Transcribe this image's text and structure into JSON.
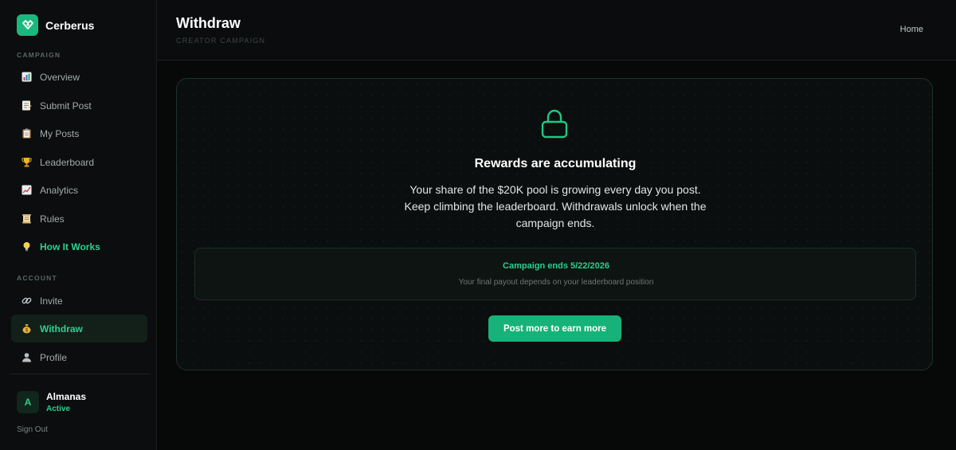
{
  "brand": {
    "name": "Cerberus",
    "logo_icon": "shield-heart-icon",
    "accent": "#19b97e"
  },
  "sidebar": {
    "campaign_label": "CAMPAIGN",
    "campaign_items": [
      {
        "label": "Overview",
        "icon": "bar-chart-icon"
      },
      {
        "label": "Submit Post",
        "icon": "memo-icon"
      },
      {
        "label": "My Posts",
        "icon": "clipboard-icon"
      },
      {
        "label": "Leaderboard",
        "icon": "trophy-icon"
      },
      {
        "label": "Analytics",
        "icon": "trend-chart-icon"
      },
      {
        "label": "Rules",
        "icon": "scroll-icon"
      },
      {
        "label": "How It Works",
        "icon": "lightbulb-icon"
      }
    ],
    "account_label": "ACCOUNT",
    "account_items": [
      {
        "label": "Invite",
        "icon": "link-icon"
      },
      {
        "label": "Withdraw",
        "icon": "money-bag-icon"
      },
      {
        "label": "Profile",
        "icon": "user-silhouette-icon"
      }
    ],
    "user": {
      "initial": "A",
      "name": "Almanas",
      "status": "Active"
    },
    "sign_out": "Sign Out"
  },
  "header": {
    "title": "Withdraw",
    "subtitle": "CREATOR CAMPAIGN",
    "home_link": "Home"
  },
  "card": {
    "icon": "lock-icon",
    "title": "Rewards are accumulating",
    "body": "Your share of the $20K pool is growing every day you post. Keep climbing the leaderboard. Withdrawals unlock when the campaign ends.",
    "info_title": "Campaign ends 5/22/2026",
    "info_subtitle": "Your final payout depends on your leaderboard position",
    "cta_label": "Post more to earn more"
  },
  "colors": {
    "accent_green": "#2bd08f",
    "button_green": "#17b27a",
    "background": "#07090a"
  }
}
